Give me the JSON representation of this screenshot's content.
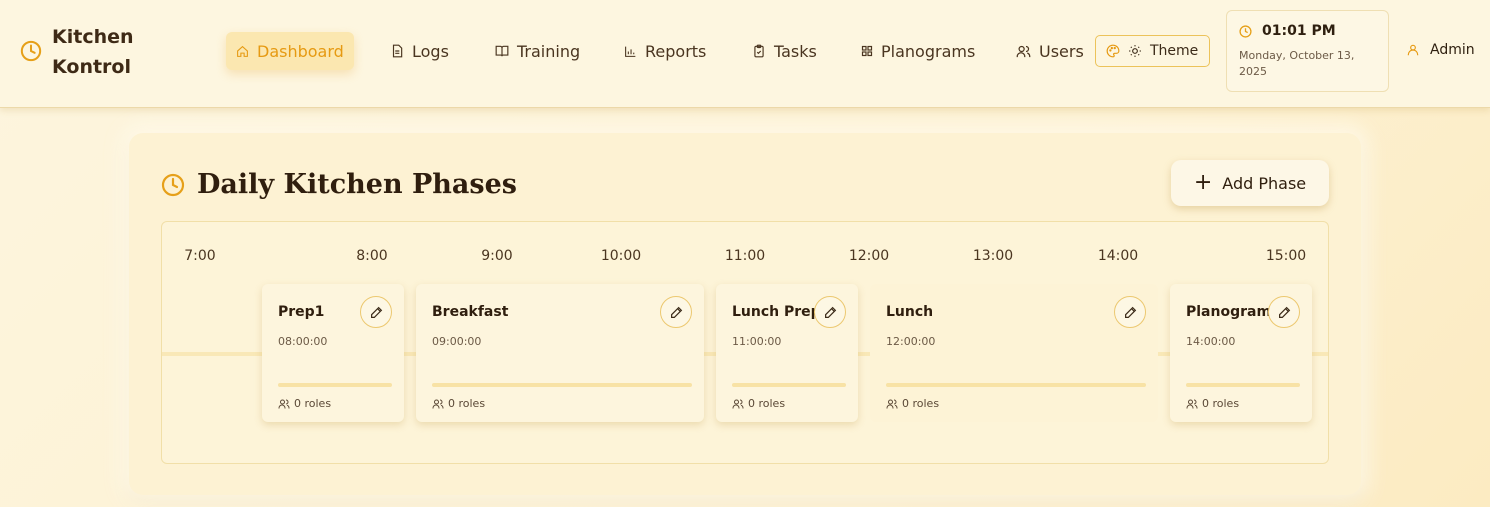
{
  "brand": {
    "line1": "Kitchen",
    "line2": "Kontrol"
  },
  "nav": {
    "dashboard": "Dashboard",
    "logs": "Logs",
    "training": "Training",
    "reports": "Reports",
    "tasks": "Tasks",
    "planograms": "Planograms",
    "users": "Users"
  },
  "theme": {
    "label": "Theme"
  },
  "clock": {
    "time": "01:01 PM",
    "date": "Monday, October 13, 2025"
  },
  "user": {
    "name": "Admin"
  },
  "main": {
    "title": "Daily Kitchen Phases",
    "add_button": "Add Phase",
    "ticks": [
      "7:00",
      "8:00",
      "9:00",
      "10:00",
      "11:00",
      "12:00",
      "13:00",
      "14:00",
      "15:00"
    ],
    "phases": [
      {
        "name": "Prep1",
        "time": "08:00:00",
        "roles": "0 roles"
      },
      {
        "name": "Breakfast",
        "time": "09:00:00",
        "roles": "0 roles"
      },
      {
        "name": "Lunch Prep",
        "time": "11:00:00",
        "roles": "0 roles"
      },
      {
        "name": "Lunch",
        "time": "12:00:00",
        "roles": "0 roles"
      },
      {
        "name": "Planogram",
        "time": "14:00:00",
        "roles": "0 roles"
      }
    ]
  },
  "colors": {
    "accent": "#e69a12",
    "background": "#fdf2d3",
    "border": "#ecc35a"
  },
  "icons": {
    "brand": "clock-icon",
    "dashboard": "home-icon",
    "logs": "document-icon",
    "training": "book-icon",
    "reports": "bar-chart-icon",
    "tasks": "clipboard-icon",
    "planograms": "grid-icon",
    "users": "users-icon",
    "theme": "palette-icon",
    "sun": "sun-icon",
    "user": "user-icon",
    "edit": "pencil-icon",
    "add": "plus-icon"
  }
}
